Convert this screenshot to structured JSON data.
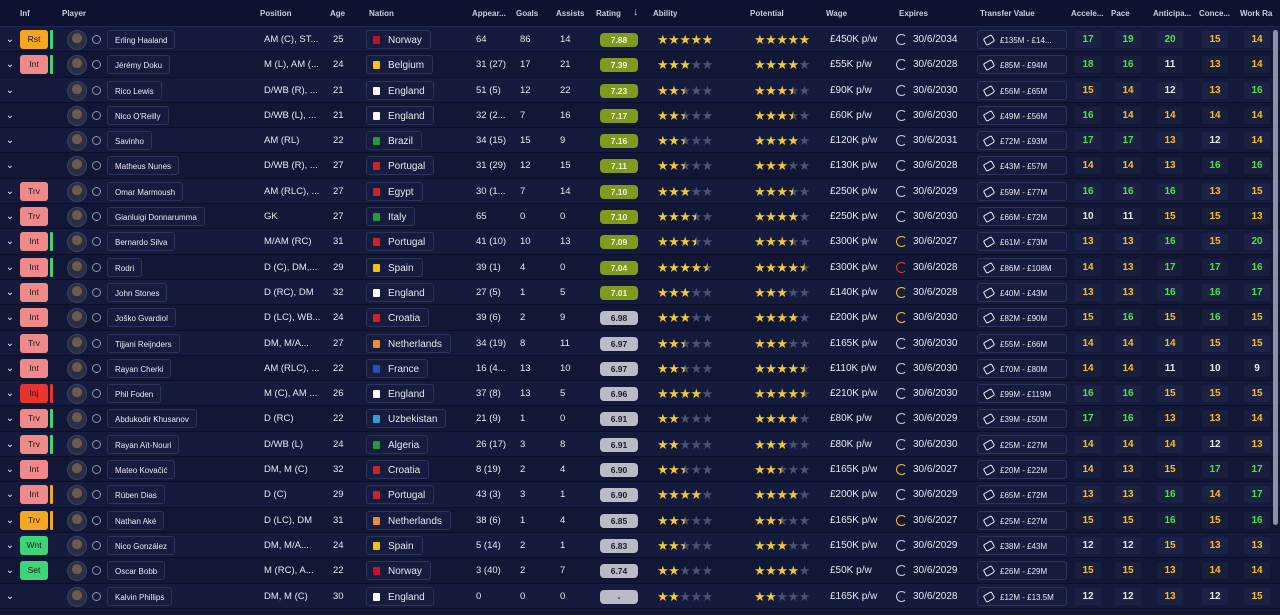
{
  "columns": {
    "inf": "Inf",
    "player": "Player",
    "position": "Position",
    "age": "Age",
    "nation": "Nation",
    "appearances": "Appear...",
    "goals": "Goals",
    "assists": "Assists",
    "rating": "Rating",
    "ability": "Ability",
    "potential": "Potential",
    "wage": "Wage",
    "expires": "Expires",
    "transfer_value": "Transfer Value",
    "acceleration": "Accele...",
    "pace": "Pace",
    "anticipation": "Anticipa...",
    "concentration": "Conce...",
    "work_rate": "Work Ra"
  },
  "colors": {
    "rating_green": "#7f9a1c",
    "rating_grey": "#b9bcc6",
    "attr_green": "#4ee24a",
    "attr_yellow": "#f5c11c",
    "attr_orange": "#f49a1a",
    "attr_white": "#e8e8ee",
    "badge_red": "#f08a8a",
    "badge_green": "#3ed478",
    "badge_orange": "#f5a623"
  },
  "players": [
    {
      "inf": "Rst",
      "inf_color": "#f5a623",
      "bar": "#3ed478",
      "name": "Erling Haaland",
      "position": "AM (C), ST...",
      "age": "25",
      "nation": "Norway",
      "flag": "#c8102e",
      "apps": "64",
      "goals": "86",
      "assists": "14",
      "rating": "7.88",
      "rc": "g",
      "ability": [
        1,
        1,
        1,
        1,
        1
      ],
      "potential": [
        1,
        1,
        1,
        1,
        1
      ],
      "wage": "£450K p/w",
      "expires": "30/6/2034",
      "ec": "#c9cde0",
      "tv": "£135M - £14...",
      "acc": "17",
      "pace": "19",
      "ant": "20",
      "con": "15",
      "wr": "14"
    },
    {
      "inf": "Int",
      "inf_color": "#f08a8a",
      "bar": "#3ed478",
      "name": "Jérémy Doku",
      "position": "M (L), AM (...",
      "age": "24",
      "nation": "Belgium",
      "flag": "#f5c400",
      "apps": "31 (27)",
      "goals": "17",
      "assists": "21",
      "rating": "7.39",
      "rc": "g",
      "ability": [
        1,
        1,
        1,
        0,
        0
      ],
      "potential": [
        1,
        1,
        1,
        1,
        0
      ],
      "wage": "£55K p/w",
      "expires": "30/6/2028",
      "ec": "#c9cde0",
      "tv": "£85M - £94M",
      "acc": "18",
      "pace": "16",
      "ant": "11",
      "con": "13",
      "wr": "14"
    },
    {
      "inf": "",
      "inf_color": "",
      "bar": "",
      "name": "Rico Lewis",
      "position": "D/WB (R), ...",
      "age": "21",
      "nation": "England",
      "flag": "#ffffff",
      "apps": "51 (5)",
      "goals": "12",
      "assists": "22",
      "rating": "7.23",
      "rc": "g",
      "ability": [
        1,
        1,
        0.5,
        0,
        0
      ],
      "potential": [
        1,
        1,
        1,
        0.5,
        0
      ],
      "wage": "£90K p/w",
      "expires": "30/6/2030",
      "ec": "#c9cde0",
      "tv": "£56M - £65M",
      "acc": "15",
      "pace": "14",
      "ant": "12",
      "con": "13",
      "wr": "16"
    },
    {
      "inf": "",
      "inf_color": "",
      "bar": "",
      "name": "Nico O'Reilly",
      "position": "D/WB (L), ...",
      "age": "21",
      "nation": "England",
      "flag": "#ffffff",
      "apps": "32 (2...",
      "goals": "7",
      "assists": "16",
      "rating": "7.17",
      "rc": "g",
      "ability": [
        1,
        1,
        0.5,
        0,
        0
      ],
      "potential": [
        1,
        1,
        1,
        0.5,
        0
      ],
      "wage": "£60K p/w",
      "expires": "30/6/2030",
      "ec": "#c9cde0",
      "tv": "£49M - £56M",
      "acc": "16",
      "pace": "14",
      "ant": "14",
      "con": "14",
      "wr": "14"
    },
    {
      "inf": "",
      "inf_color": "",
      "bar": "",
      "name": "Savinho",
      "position": "AM (RL)",
      "age": "22",
      "nation": "Brazil",
      "flag": "#1f9b3a",
      "apps": "34 (15)",
      "goals": "15",
      "assists": "9",
      "rating": "7.16",
      "rc": "g",
      "ability": [
        1,
        1,
        0.5,
        0,
        0
      ],
      "potential": [
        1,
        1,
        1,
        1,
        0
      ],
      "wage": "£120K p/w",
      "expires": "30/6/2031",
      "ec": "#c9cde0",
      "tv": "£72M - £93M",
      "acc": "17",
      "pace": "17",
      "ant": "13",
      "con": "12",
      "wr": "14"
    },
    {
      "inf": "",
      "inf_color": "",
      "bar": "",
      "name": "Matheus Nunes",
      "position": "D/WB (R), ...",
      "age": "27",
      "nation": "Portugal",
      "flag": "#d21f2a",
      "apps": "31 (29)",
      "goals": "12",
      "assists": "15",
      "rating": "7.11",
      "rc": "g",
      "ability": [
        1,
        1,
        0.5,
        0,
        0
      ],
      "potential": [
        1,
        1,
        1,
        0,
        0
      ],
      "wage": "£130K p/w",
      "expires": "30/6/2028",
      "ec": "#c9cde0",
      "tv": "£43M - £57M",
      "acc": "14",
      "pace": "14",
      "ant": "13",
      "con": "16",
      "wr": "16"
    },
    {
      "inf": "Trv",
      "inf_color": "#f08a8a",
      "bar": "",
      "name": "Omar Marmoush",
      "position": "AM (RLC), ...",
      "age": "27",
      "nation": "Egypt",
      "flag": "#d21f2a",
      "apps": "30 (1...",
      "goals": "7",
      "assists": "14",
      "rating": "7.10",
      "rc": "g",
      "ability": [
        1,
        1,
        1,
        0,
        0
      ],
      "potential": [
        1,
        1,
        1,
        0.5,
        0
      ],
      "wage": "£250K p/w",
      "expires": "30/6/2029",
      "ec": "#c9cde0",
      "tv": "£59M - £77M",
      "acc": "16",
      "pace": "16",
      "ant": "16",
      "con": "13",
      "wr": "15"
    },
    {
      "inf": "Trv",
      "inf_color": "#f08a8a",
      "bar": "",
      "name": "Gianluigi Donnarumma",
      "position": "GK",
      "age": "27",
      "nation": "Italy",
      "flag": "#1f9b3a",
      "apps": "65",
      "goals": "0",
      "assists": "0",
      "rating": "7.10",
      "rc": "g",
      "ability": [
        1,
        1,
        1,
        0.5,
        0
      ],
      "potential": [
        1,
        1,
        1,
        1,
        0
      ],
      "wage": "£250K p/w",
      "expires": "30/6/2030",
      "ec": "#c9cde0",
      "tv": "£66M - £72M",
      "acc": "10",
      "pace": "11",
      "ant": "15",
      "con": "15",
      "wr": "13"
    },
    {
      "inf": "Int",
      "inf_color": "#f08a8a",
      "bar": "#3ed478",
      "name": "Bernardo Silva",
      "position": "M/AM (RC)",
      "age": "31",
      "nation": "Portugal",
      "flag": "#d21f2a",
      "apps": "41 (10)",
      "goals": "10",
      "assists": "13",
      "rating": "7.09",
      "rc": "g",
      "ability": [
        1,
        1,
        1,
        0.5,
        0
      ],
      "potential": [
        1,
        1,
        1,
        0.5,
        0
      ],
      "wage": "£300K p/w",
      "expires": "30/6/2027",
      "ec": "#f5c11c",
      "tv": "£61M - £73M",
      "acc": "13",
      "pace": "13",
      "ant": "16",
      "con": "15",
      "wr": "20"
    },
    {
      "inf": "Int",
      "inf_color": "#f08a8a",
      "bar": "#3ed478",
      "name": "Rodri",
      "position": "D (C), DM,...",
      "age": "29",
      "nation": "Spain",
      "flag": "#f5c400",
      "apps": "39 (1)",
      "goals": "4",
      "assists": "0",
      "rating": "7.04",
      "rc": "g",
      "ability": [
        1,
        1,
        1,
        1,
        0.5
      ],
      "potential": [
        1,
        1,
        1,
        1,
        0.5
      ],
      "wage": "£300K p/w",
      "expires": "30/6/2028",
      "ec": "#e8342e",
      "tv": "£86M - £108M",
      "acc": "14",
      "pace": "13",
      "ant": "17",
      "con": "17",
      "wr": "16"
    },
    {
      "inf": "Int",
      "inf_color": "#f08a8a",
      "bar": "",
      "name": "John Stones",
      "position": "D (RC), DM",
      "age": "32",
      "nation": "England",
      "flag": "#ffffff",
      "apps": "27 (5)",
      "goals": "1",
      "assists": "5",
      "rating": "7.01",
      "rc": "g",
      "ability": [
        1,
        1,
        1,
        0,
        0
      ],
      "potential": [
        1,
        1,
        1,
        0,
        0
      ],
      "wage": "£140K p/w",
      "expires": "30/6/2028",
      "ec": "#f5c11c",
      "tv": "£40M - £43M",
      "acc": "13",
      "pace": "13",
      "ant": "16",
      "con": "16",
      "wr": "17"
    },
    {
      "inf": "Int",
      "inf_color": "#f08a8a",
      "bar": "",
      "name": "Joško Gvardiol",
      "position": "D (LC), WB...",
      "age": "24",
      "nation": "Croatia",
      "flag": "#d21f2a",
      "apps": "39 (6)",
      "goals": "2",
      "assists": "9",
      "rating": "6.98",
      "rc": "w",
      "ability": [
        1,
        1,
        1,
        0,
        0
      ],
      "potential": [
        1,
        1,
        1,
        1,
        0
      ],
      "wage": "£200K p/w",
      "expires": "30/6/2030",
      "ec": "#f5c11c",
      "tv": "£82M - £90M",
      "acc": "15",
      "pace": "16",
      "ant": "15",
      "con": "16",
      "wr": "15"
    },
    {
      "inf": "Trv",
      "inf_color": "#f08a8a",
      "bar": "",
      "name": "Tijjani Reijnders",
      "position": "DM, M/A...",
      "age": "27",
      "nation": "Netherlands",
      "flag": "#f08a2a",
      "apps": "34 (19)",
      "goals": "8",
      "assists": "11",
      "rating": "6.97",
      "rc": "w",
      "ability": [
        1,
        1,
        0.5,
        0,
        0
      ],
      "potential": [
        1,
        1,
        1,
        0,
        0
      ],
      "wage": "£165K p/w",
      "expires": "30/6/2030",
      "ec": "#c9cde0",
      "tv": "£55M - £66M",
      "acc": "14",
      "pace": "14",
      "ant": "14",
      "con": "15",
      "wr": "15"
    },
    {
      "inf": "Int",
      "inf_color": "#f08a8a",
      "bar": "",
      "name": "Rayan Cherki",
      "position": "AM (RLC), ...",
      "age": "22",
      "nation": "France",
      "flag": "#2a4fb0",
      "apps": "16 (4...",
      "goals": "13",
      "assists": "10",
      "rating": "6.97",
      "rc": "w",
      "ability": [
        1,
        1,
        0.5,
        0,
        0
      ],
      "potential": [
        1,
        1,
        1,
        1,
        0.5
      ],
      "wage": "£110K p/w",
      "expires": "30/6/2030",
      "ec": "#c9cde0",
      "tv": "£70M - £80M",
      "acc": "14",
      "pace": "14",
      "ant": "11",
      "con": "10",
      "wr": "9"
    },
    {
      "inf": "Inj",
      "inf_color": "#e8342e",
      "bar": "#e8342e",
      "name": "Phil Foden",
      "position": "M (C), AM ...",
      "age": "26",
      "nation": "England",
      "flag": "#ffffff",
      "apps": "37 (8)",
      "goals": "13",
      "assists": "5",
      "rating": "6.96",
      "rc": "w",
      "ability": [
        1,
        1,
        1,
        1,
        0
      ],
      "potential": [
        1,
        1,
        1,
        1,
        0.5
      ],
      "wage": "£210K p/w",
      "expires": "30/6/2030",
      "ec": "#c9cde0",
      "tv": "£99M - £119M",
      "acc": "16",
      "pace": "16",
      "ant": "15",
      "con": "15",
      "wr": "15"
    },
    {
      "inf": "Trv",
      "inf_color": "#f08a8a",
      "bar": "#3ed478",
      "name": "Abdukodir Khusanov",
      "position": "D (RC)",
      "age": "22",
      "nation": "Uzbekistan",
      "flag": "#2aa0d8",
      "apps": "21 (9)",
      "goals": "1",
      "assists": "0",
      "rating": "6.91",
      "rc": "w",
      "ability": [
        1,
        1,
        0,
        0,
        0
      ],
      "potential": [
        1,
        1,
        1,
        1,
        0
      ],
      "wage": "£80K p/w",
      "expires": "30/6/2029",
      "ec": "#c9cde0",
      "tv": "£39M - £50M",
      "acc": "17",
      "pace": "16",
      "ant": "13",
      "con": "13",
      "wr": "14"
    },
    {
      "inf": "Trv",
      "inf_color": "#f08a8a",
      "bar": "#3ed478",
      "name": "Rayan Aït-Nouri",
      "position": "D/WB (L)",
      "age": "24",
      "nation": "Algeria",
      "flag": "#1f9b3a",
      "apps": "26 (17)",
      "goals": "3",
      "assists": "8",
      "rating": "6.91",
      "rc": "w",
      "ability": [
        1,
        1,
        0,
        0,
        0
      ],
      "potential": [
        1,
        1,
        1,
        0,
        0
      ],
      "wage": "£80K p/w",
      "expires": "30/6/2030",
      "ec": "#c9cde0",
      "tv": "£25M - £27M",
      "acc": "14",
      "pace": "14",
      "ant": "14",
      "con": "12",
      "wr": "13"
    },
    {
      "inf": "Int",
      "inf_color": "#f08a8a",
      "bar": "",
      "name": "Mateo Kovačić",
      "position": "DM, M (C)",
      "age": "32",
      "nation": "Croatia",
      "flag": "#d21f2a",
      "apps": "8 (19)",
      "goals": "2",
      "assists": "4",
      "rating": "6.90",
      "rc": "w",
      "ability": [
        1,
        1,
        0.5,
        0,
        0
      ],
      "potential": [
        1,
        1,
        0.5,
        0,
        0
      ],
      "wage": "£165K p/w",
      "expires": "30/6/2027",
      "ec": "#f5c11c",
      "tv": "£20M - £22M",
      "acc": "14",
      "pace": "13",
      "ant": "15",
      "con": "17",
      "wr": "17"
    },
    {
      "inf": "Int",
      "inf_color": "#f08a8a",
      "bar": "#f5a623",
      "name": "Rúben Dias",
      "position": "D (C)",
      "age": "29",
      "nation": "Portugal",
      "flag": "#d21f2a",
      "apps": "43 (3)",
      "goals": "3",
      "assists": "1",
      "rating": "6.90",
      "rc": "w",
      "ability": [
        1,
        1,
        1,
        1,
        0
      ],
      "potential": [
        1,
        1,
        1,
        1,
        0
      ],
      "wage": "£200K p/w",
      "expires": "30/6/2029",
      "ec": "#c9cde0",
      "tv": "£65M - £72M",
      "acc": "13",
      "pace": "13",
      "ant": "16",
      "con": "14",
      "wr": "17"
    },
    {
      "inf": "Trv",
      "inf_color": "#f5a623",
      "bar": "#f5a623",
      "name": "Nathan Aké",
      "position": "D (LC), DM",
      "age": "31",
      "nation": "Netherlands",
      "flag": "#f08a2a",
      "apps": "38 (6)",
      "goals": "1",
      "assists": "4",
      "rating": "6.85",
      "rc": "w",
      "ability": [
        1,
        1,
        0.5,
        0,
        0
      ],
      "potential": [
        1,
        1,
        0.5,
        0,
        0
      ],
      "wage": "£165K p/w",
      "expires": "30/6/2027",
      "ec": "#f5c11c",
      "tv": "£25M - £27M",
      "acc": "15",
      "pace": "15",
      "ant": "16",
      "con": "15",
      "wr": "16"
    },
    {
      "inf": "Wnt",
      "inf_color": "#3ed478",
      "bar": "",
      "name": "Nico González",
      "position": "DM, M/A...",
      "age": "24",
      "nation": "Spain",
      "flag": "#f5c400",
      "apps": "5 (14)",
      "goals": "2",
      "assists": "1",
      "rating": "6.83",
      "rc": "w",
      "ability": [
        1,
        1,
        0.5,
        0,
        0
      ],
      "potential": [
        1,
        1,
        1,
        0,
        0
      ],
      "wage": "£150K p/w",
      "expires": "30/6/2029",
      "ec": "#c9cde0",
      "tv": "£38M - £43M",
      "acc": "12",
      "pace": "12",
      "ant": "15",
      "con": "13",
      "wr": "13"
    },
    {
      "inf": "Set",
      "inf_color": "#3ed478",
      "bar": "",
      "name": "Oscar Bobb",
      "position": "M (RC), A...",
      "age": "22",
      "nation": "Norway",
      "flag": "#c8102e",
      "apps": "3 (40)",
      "goals": "2",
      "assists": "7",
      "rating": "6.74",
      "rc": "w",
      "ability": [
        1,
        1,
        0,
        0,
        0
      ],
      "potential": [
        1,
        1,
        1,
        1,
        0
      ],
      "wage": "£50K p/w",
      "expires": "30/6/2029",
      "ec": "#c9cde0",
      "tv": "£26M - £29M",
      "acc": "15",
      "pace": "15",
      "ant": "13",
      "con": "14",
      "wr": "14"
    },
    {
      "inf": "",
      "inf_color": "",
      "bar": "",
      "name": "Kalvin Phillips",
      "position": "DM, M (C)",
      "age": "30",
      "nation": "England",
      "flag": "#ffffff",
      "apps": "0",
      "goals": "0",
      "assists": "0",
      "rating": "-",
      "rc": "w",
      "ability": [
        1,
        1,
        0,
        0,
        0
      ],
      "potential": [
        1,
        1,
        0,
        0,
        0
      ],
      "wage": "£165K p/w",
      "expires": "30/6/2028",
      "ec": "#c9cde0",
      "tv": "£12M - £13.5M",
      "acc": "12",
      "pace": "12",
      "ant": "13",
      "con": "12",
      "wr": "15"
    }
  ]
}
